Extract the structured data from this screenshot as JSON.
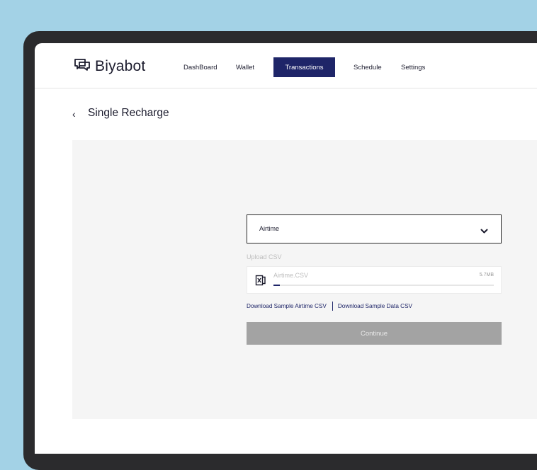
{
  "brand": {
    "name": "Biyabot"
  },
  "nav": {
    "items": [
      "DashBoard",
      "Wallet",
      "Transactions",
      "Schedule",
      "Settings"
    ],
    "active": "Transactions"
  },
  "page": {
    "back_glyph": "‹",
    "title": "Single Recharge"
  },
  "form": {
    "type_select": {
      "value": "Airtime"
    },
    "upload_label": "Upload CSV",
    "file": {
      "name": "Airtime.CSV",
      "size": "5.7MB",
      "progress_percent": 3
    },
    "links": {
      "airtime_sample": "Download Sample Airtime CSV",
      "data_sample": "Download Sample Data CSV"
    },
    "continue_label": "Continue"
  },
  "colors": {
    "background": "#a3d2e6",
    "accent": "#1e2568",
    "button_disabled": "#a3a3a3",
    "panel": "#f5f5f5"
  },
  "icons": [
    "biyabot-logo-icon",
    "back-chevron-icon",
    "chevron-down-icon",
    "excel-file-icon"
  ]
}
